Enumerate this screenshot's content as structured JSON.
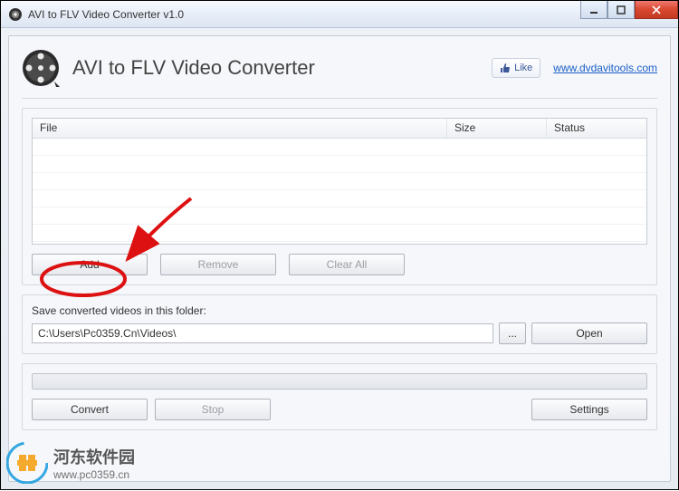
{
  "window": {
    "title": "AVI to FLV Video Converter v1.0"
  },
  "header": {
    "app_title": "AVI to FLV Video Converter",
    "like_label": "Like",
    "site_link": "www.dvdavitools.com"
  },
  "filelist": {
    "columns": {
      "file": "File",
      "size": "Size",
      "status": "Status"
    },
    "rows": []
  },
  "buttons": {
    "add": "Add",
    "remove": "Remove",
    "clear_all": "Clear All",
    "browse": "...",
    "open": "Open",
    "convert": "Convert",
    "stop": "Stop",
    "settings": "Settings"
  },
  "output": {
    "label": "Save converted videos in this folder:",
    "path": "C:\\Users\\Pc0359.Cn\\Videos\\"
  },
  "watermark": {
    "title": "河东软件园",
    "url": "www.pc0359.cn"
  }
}
